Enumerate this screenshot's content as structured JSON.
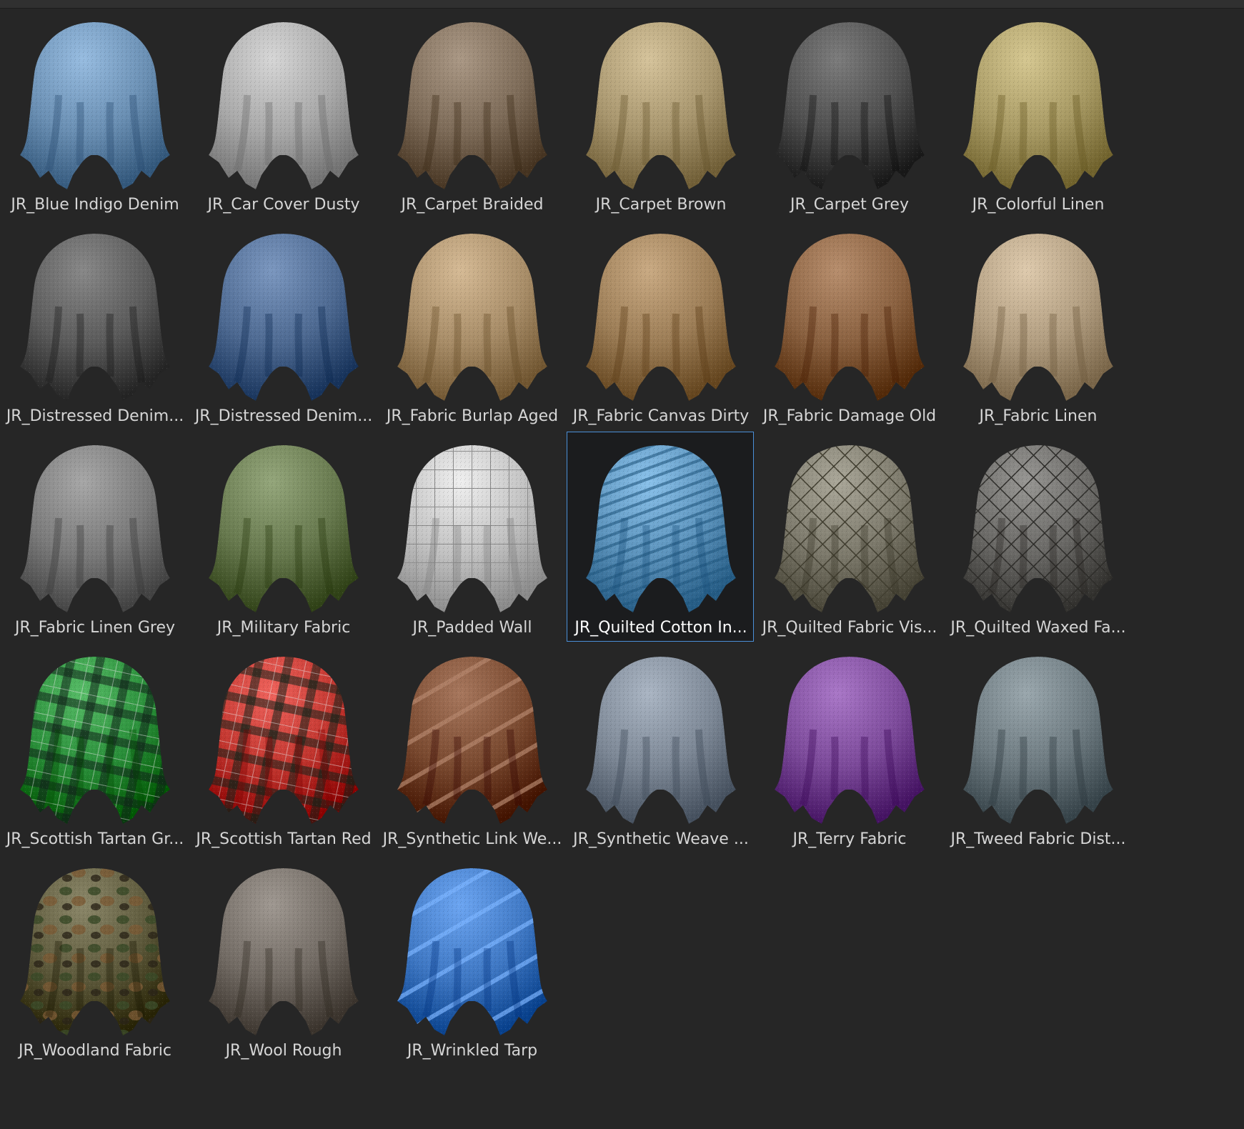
{
  "materials": [
    {
      "label": "JR_Blue Indigo Denim",
      "color": "#6a8fb3",
      "pattern": "plain"
    },
    {
      "label": "JR_Car Cover Dusty",
      "color": "#a9a9a9",
      "pattern": "plain"
    },
    {
      "label": "JR_Carpet Braided",
      "color": "#7d6b58",
      "pattern": "plain"
    },
    {
      "label": "JR_Carpet Brown",
      "color": "#a8966e",
      "pattern": "plain"
    },
    {
      "label": "JR_Carpet Grey",
      "color": "#4f4f4f",
      "pattern": "plain"
    },
    {
      "label": "JR_Colorful Linen",
      "color": "#a89a64",
      "pattern": "plain"
    },
    {
      "label": "JR_Distressed Denim...",
      "color": "#5b5b5b",
      "pattern": "plain"
    },
    {
      "label": "JR_Distressed Denim...",
      "color": "#4e6a92",
      "pattern": "plain"
    },
    {
      "label": "JR_Fabric Burlap Aged",
      "color": "#a88d68",
      "pattern": "plain"
    },
    {
      "label": "JR_Fabric Canvas Dirty",
      "color": "#9c7d56",
      "pattern": "plain"
    },
    {
      "label": "JR_Fabric Damage Old",
      "color": "#8a6140",
      "pattern": "plain"
    },
    {
      "label": "JR_Fabric Linen",
      "color": "#b19d80",
      "pattern": "plain"
    },
    {
      "label": "JR_Fabric Linen Grey",
      "color": "#7a7a7a",
      "pattern": "plain"
    },
    {
      "label": "JR_Military Fabric",
      "color": "#67794e",
      "pattern": "plain"
    },
    {
      "label": "JR_Padded Wall",
      "color": "#c2c2c2",
      "pattern": "grid"
    },
    {
      "label": "JR_Quilted Cotton In...",
      "color": "#5d94bd",
      "pattern": "stripes"
    },
    {
      "label": "JR_Quilted Fabric Vis...",
      "color": "#7d7a6c",
      "pattern": "diamond"
    },
    {
      "label": "JR_Quilted Waxed Fa...",
      "color": "#6a6966",
      "pattern": "diamond"
    },
    {
      "label": "JR_Scottish Tartan Gr...",
      "color": "#2a8f3a",
      "pattern": "tartan"
    },
    {
      "label": "JR_Scottish Tartan Red",
      "color": "#c2362f",
      "pattern": "tartan"
    },
    {
      "label": "JR_Synthetic Link We...",
      "color": "#7a4a30",
      "pattern": "bands"
    },
    {
      "label": "JR_Synthetic Weave ...",
      "color": "#7d8896",
      "pattern": "plain"
    },
    {
      "label": "JR_Terry Fabric",
      "color": "#7c4a9a",
      "pattern": "plain"
    },
    {
      "label": "JR_Tweed Fabric Dist...",
      "color": "#6d7a80",
      "pattern": "plain"
    },
    {
      "label": "JR_Woodland Fabric",
      "color": "#5e5a3c",
      "pattern": "camo"
    },
    {
      "label": "JR_Wool Rough",
      "color": "#726b64",
      "pattern": "plain"
    },
    {
      "label": "JR_Wrinkled Tarp",
      "color": "#3f78c4",
      "pattern": "bands"
    }
  ],
  "selected_index": 15
}
